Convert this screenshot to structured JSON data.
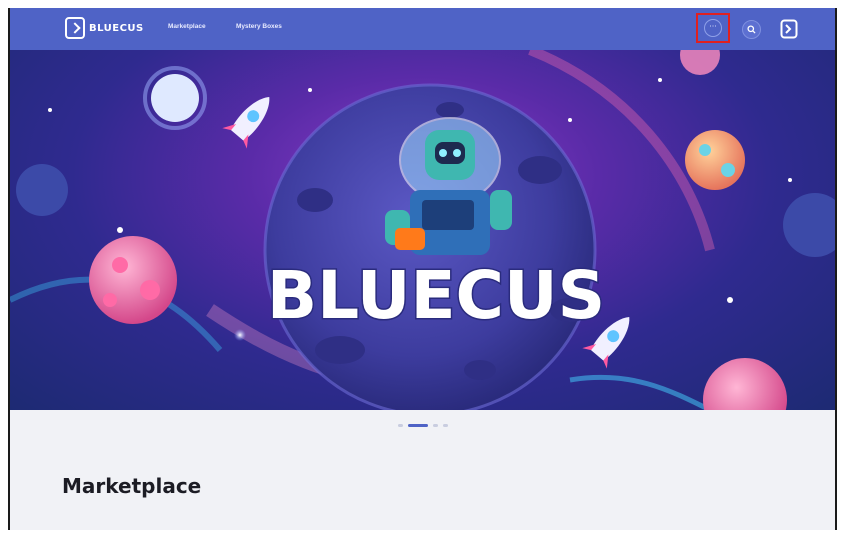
{
  "navbar": {
    "brand": "BLUECUS",
    "links": [
      {
        "label": "Marketplace"
      },
      {
        "label": "Mystery Boxes"
      }
    ],
    "more_label": "···",
    "icons": {
      "search": "search-icon",
      "login": "login-icon",
      "more": "more-icon"
    }
  },
  "hero": {
    "banner_title": "BLUECUS",
    "active_slide": 2,
    "slides_count": 4
  },
  "main": {
    "section_title": "Marketplace"
  },
  "colors": {
    "navbar": "#4f63c6",
    "accent": "#4f63c6",
    "highlight_box": "#e02020"
  }
}
